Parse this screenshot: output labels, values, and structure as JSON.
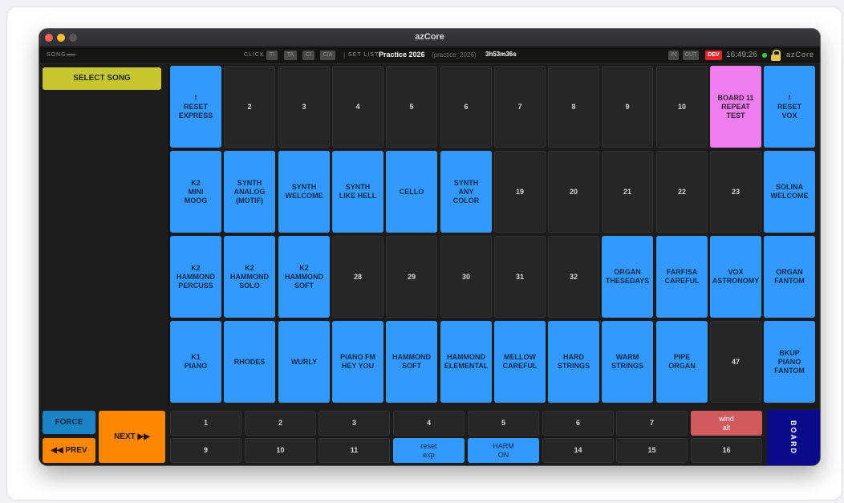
{
  "window": {
    "title": "azCore"
  },
  "status": {
    "song_label": "SONG",
    "song_value": "—",
    "click_label": "CLICK",
    "click_chips": [
      "TI",
      "TA",
      "CI",
      "CIA"
    ],
    "separator": "|",
    "setlist_label": "SET LIST",
    "setlist_name": "Practice 2026",
    "setlist_file": "(practice_2026)",
    "duration": "3h53m36s",
    "in_label": "IN",
    "out_label": "OUT",
    "dev_label": "DEV",
    "time": "16:49:26",
    "app_name": "azCore",
    "indicator_color": "#2ecc40"
  },
  "sidebar": {
    "select_song": "SELECT SONG"
  },
  "pads": [
    {
      "label": "!\nRESET\nEXPRESS",
      "color": "blue"
    },
    {
      "label": "2",
      "color": "dark"
    },
    {
      "label": "3",
      "color": "dark"
    },
    {
      "label": "4",
      "color": "dark"
    },
    {
      "label": "5",
      "color": "dark"
    },
    {
      "label": "6",
      "color": "dark"
    },
    {
      "label": "7",
      "color": "dark"
    },
    {
      "label": "8",
      "color": "dark"
    },
    {
      "label": "9",
      "color": "dark"
    },
    {
      "label": "10",
      "color": "dark"
    },
    {
      "label": "BOARD 11\nREPEAT\nTEST",
      "color": "pink"
    },
    {
      "label": "!\nRESET\nVOX",
      "color": "blue"
    },
    {
      "label": "K2\nMINI\nMOOG",
      "color": "blue"
    },
    {
      "label": "SYNTH\nANALOG\n(MOTIF)",
      "color": "blue"
    },
    {
      "label": "SYNTH\nWELCOME",
      "color": "blue"
    },
    {
      "label": "SYNTH\nLIKE HELL",
      "color": "blue"
    },
    {
      "label": "CELLO",
      "color": "blue"
    },
    {
      "label": "SYNTH\nANY\nCOLOR",
      "color": "blue"
    },
    {
      "label": "19",
      "color": "dark"
    },
    {
      "label": "20",
      "color": "dark"
    },
    {
      "label": "21",
      "color": "dark"
    },
    {
      "label": "22",
      "color": "dark"
    },
    {
      "label": "23",
      "color": "dark"
    },
    {
      "label": "SOLINA\nWELCOME",
      "color": "blue"
    },
    {
      "label": "K2\nHAMMOND\nPERCUSS",
      "color": "blue"
    },
    {
      "label": "K2\nHAMMOND\nSOLO",
      "color": "blue"
    },
    {
      "label": "K2\nHAMMOND\nSOFT",
      "color": "blue"
    },
    {
      "label": "28",
      "color": "dark"
    },
    {
      "label": "29",
      "color": "dark"
    },
    {
      "label": "30",
      "color": "dark"
    },
    {
      "label": "31",
      "color": "dark"
    },
    {
      "label": "32",
      "color": "dark"
    },
    {
      "label": "ORGAN\nTHESEDAYS",
      "color": "blue"
    },
    {
      "label": "FARFISA\nCAREFUL",
      "color": "blue"
    },
    {
      "label": "VOX\nASTRONOMY",
      "color": "blue"
    },
    {
      "label": "ORGAN\nFANTOM",
      "color": "blue"
    },
    {
      "label": "K1\nPIANO",
      "color": "blue"
    },
    {
      "label": "RHODES",
      "color": "blue"
    },
    {
      "label": "WURLY",
      "color": "blue"
    },
    {
      "label": "PIANO FM\nHEY YOU",
      "color": "blue"
    },
    {
      "label": "HAMMOND\nSOFT",
      "color": "blue"
    },
    {
      "label": "HAMMOND\nELEMENTAL",
      "color": "blue"
    },
    {
      "label": "MELLOW\nCAREFUL",
      "color": "blue"
    },
    {
      "label": "HARD\nSTRINGS",
      "color": "blue"
    },
    {
      "label": "WARM\nSTRINGS",
      "color": "blue"
    },
    {
      "label": "PIPE\nORGAN",
      "color": "blue"
    },
    {
      "label": "47",
      "color": "dark"
    },
    {
      "label": "BKUP\nPIANO\nFANTOM",
      "color": "blue"
    }
  ],
  "controls": {
    "force": "FORCE",
    "prev": "◀◀ PREV",
    "next": "NEXT ▶▶",
    "board": "BOARD"
  },
  "bottom_buttons": [
    {
      "label": "1",
      "color": "dark"
    },
    {
      "label": "2",
      "color": "dark"
    },
    {
      "label": "3",
      "color": "dark"
    },
    {
      "label": "4",
      "color": "dark"
    },
    {
      "label": "5",
      "color": "dark"
    },
    {
      "label": "6",
      "color": "dark"
    },
    {
      "label": "7",
      "color": "dark"
    },
    {
      "label": "wind\nalt",
      "color": "red"
    },
    {
      "label": "9",
      "color": "dark"
    },
    {
      "label": "10",
      "color": "dark"
    },
    {
      "label": "11",
      "color": "dark"
    },
    {
      "label": "reset\nexp",
      "color": "blue"
    },
    {
      "label": "HARM\nON",
      "color": "blue"
    },
    {
      "label": "14",
      "color": "dark"
    },
    {
      "label": "15",
      "color": "dark"
    },
    {
      "label": "16",
      "color": "dark"
    }
  ]
}
